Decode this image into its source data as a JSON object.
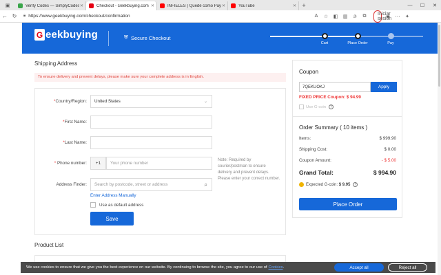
{
  "browser": {
    "tabs": [
      {
        "label": "Verify Codes — SimplyCodes",
        "color": "#3aa54a"
      },
      {
        "label": "Checkout - Geekbuying.com",
        "color": "#e60012"
      },
      {
        "label": "INFIELES | Quedé como Payasa",
        "color": "#ff0000"
      },
      {
        "label": "YouTube",
        "color": "#ff0000"
      }
    ],
    "url": "https://www.geekbuying.com/checkout/confirmation",
    "signin_label": "Iniciar sesión"
  },
  "header": {
    "logo_letter": "G",
    "logo_text": "eekbuying",
    "secure_label": "Secure Checkout",
    "steps": [
      {
        "label": "Cart",
        "done": true
      },
      {
        "label": "Place Order",
        "done": true
      },
      {
        "label": "Pay",
        "done": false
      }
    ]
  },
  "shipping": {
    "title": "Shipping Address",
    "notice": "To ensure delivery and prevent delays, please make sure your complete address is in English.",
    "country_label": "Country/Region:",
    "country_value": "United States",
    "first_name_label": "First Name:",
    "last_name_label": "Last Name:",
    "phone_label": "Phone number:",
    "phone_prefix": "+1",
    "phone_placeholder": "Your phone number",
    "phone_note": "Note: Required by courier/postman to ensure delivery and prevent delays. Please enter your correct number.",
    "finder_label": "Address Finder:",
    "finder_placeholder": "Search by postcode, street or address",
    "manual_link": "Enter Address Manually",
    "default_label": "Use as default address",
    "save_label": "Save"
  },
  "product_list": {
    "title": "Product List"
  },
  "coupon": {
    "title": "Coupon",
    "code": "7QEKUOKJ",
    "apply_label": "Apply",
    "fixed_text": "FIXED PRICE Coupon: $ 94.99",
    "use_label": "Use G-coin"
  },
  "summary": {
    "title": "Order Summary ( 10 items )",
    "items_label": "Items:",
    "items_value": "$ 999.90",
    "shipping_label": "Shipping Cost:",
    "shipping_value": "$ 0.00",
    "coupon_label": "Coupon Amount:",
    "coupon_value": "- $ 5.00",
    "grand_label": "Grand Total:",
    "grand_value": "$ 994.90",
    "gcoin_label": "Expected G-coin:",
    "gcoin_value": "$ 9.95",
    "place_label": "Place Order"
  },
  "cookie": {
    "text": "We use cookies to ensure that we give you the best experience on our website. By continuing to browse the site, you agree to our use of",
    "link": "Cookies",
    "accept_label": "Accept all",
    "reject_label": "Reject all"
  },
  "colors": {
    "brand_blue": "#1668d9",
    "brand_red": "#e60012",
    "error_red": "#e33"
  }
}
